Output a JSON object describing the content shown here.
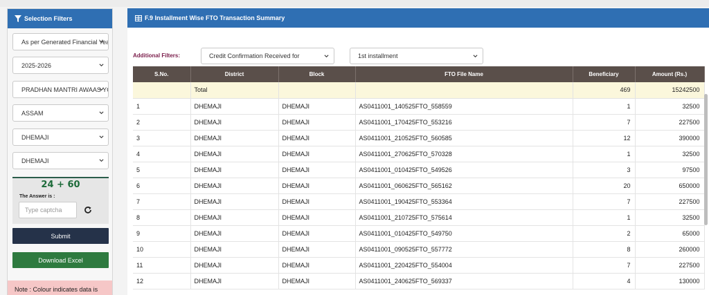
{
  "sidebar": {
    "title": "Selection Filters",
    "selects": [
      "As per Generated Financial Year",
      "2025-2026",
      "PRADHAN MANTRI AWAAS YOJANA",
      "ASSAM",
      "DHEMAJI",
      "DHEMAJI"
    ],
    "captcha_code": "24 + 60",
    "answer_label": "The Answer is :",
    "captcha_placeholder": "Type captcha",
    "submit_label": "Submit",
    "excel_label": "Download Excel",
    "note": "Note : Colour indicates data is"
  },
  "main": {
    "title": "F.9 Installment Wise FTO Transaction Summary",
    "filters_label": "Additional Filters:",
    "filter_1": "Credit Confirmation Received for",
    "filter_2": "1st installment"
  },
  "table": {
    "headers": [
      "S.No.",
      "District",
      "Block",
      "FTO File Name",
      "Beneficiary",
      "Amount (Rs.)"
    ],
    "total": {
      "label": "Total",
      "beneficiary": "469",
      "amount": "15242500"
    },
    "rows": [
      [
        "1",
        "DHEMAJI",
        "DHEMAJI",
        "AS0411001_140525FTO_558559",
        "1",
        "32500"
      ],
      [
        "2",
        "DHEMAJI",
        "DHEMAJI",
        "AS0411001_170425FTO_553216",
        "7",
        "227500"
      ],
      [
        "3",
        "DHEMAJI",
        "DHEMAJI",
        "AS0411001_210525FTO_560585",
        "12",
        "390000"
      ],
      [
        "4",
        "DHEMAJI",
        "DHEMAJI",
        "AS0411001_270625FTO_570328",
        "1",
        "32500"
      ],
      [
        "5",
        "DHEMAJI",
        "DHEMAJI",
        "AS0411001_010425FTO_549526",
        "3",
        "97500"
      ],
      [
        "6",
        "DHEMAJI",
        "DHEMAJI",
        "AS0411001_060625FTO_565162",
        "20",
        "650000"
      ],
      [
        "7",
        "DHEMAJI",
        "DHEMAJI",
        "AS0411001_190425FTO_553364",
        "7",
        "227500"
      ],
      [
        "8",
        "DHEMAJI",
        "DHEMAJI",
        "AS0411001_210725FTO_575614",
        "1",
        "32500"
      ],
      [
        "9",
        "DHEMAJI",
        "DHEMAJI",
        "AS0411001_010425FTO_549750",
        "2",
        "65000"
      ],
      [
        "10",
        "DHEMAJI",
        "DHEMAJI",
        "AS0411001_090525FTO_557772",
        "8",
        "260000"
      ],
      [
        "11",
        "DHEMAJI",
        "DHEMAJI",
        "AS0411001_220425FTO_554004",
        "7",
        "227500"
      ],
      [
        "12",
        "DHEMAJI",
        "DHEMAJI",
        "AS0411001_240625FTO_569337",
        "4",
        "130000"
      ]
    ]
  },
  "colors": {
    "header_blue": "#2f6fb3",
    "table_header": "#5a4f4a",
    "total_row": "#fbf7dc",
    "submit": "#253249",
    "excel": "#2e7a3f",
    "note_bg": "#f6c7c7"
  },
  "icons": [
    "funnel-icon",
    "table-icon",
    "chevron-down-icon",
    "refresh-icon"
  ]
}
